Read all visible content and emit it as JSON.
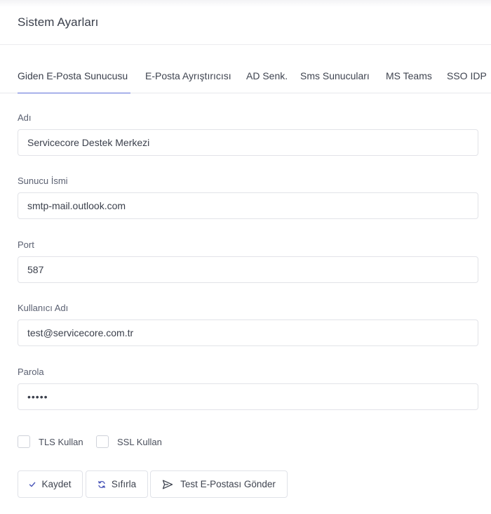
{
  "header": {
    "title": "Sistem Ayarları"
  },
  "tabs": [
    {
      "label": "Giden E-Posta Sunucusu",
      "active": true
    },
    {
      "label": "E-Posta Ayrıştırıcısı",
      "active": false
    },
    {
      "label": "AD Senk.",
      "active": false
    },
    {
      "label": "Sms Sunucuları",
      "active": false
    },
    {
      "label": "MS Teams",
      "active": false
    },
    {
      "label": "SSO IDP",
      "active": false
    }
  ],
  "form": {
    "name": {
      "label": "Adı",
      "value": "Servicecore Destek Merkezi"
    },
    "server": {
      "label": "Sunucu İsmi",
      "value": "smtp-mail.outlook.com"
    },
    "port": {
      "label": "Port",
      "value": "587"
    },
    "username": {
      "label": "Kullanıcı Adı",
      "value": "test@servicecore.com.tr"
    },
    "password": {
      "label": "Parola",
      "value": "•••••"
    },
    "tls": {
      "label": "TLS Kullan",
      "checked": false
    },
    "ssl": {
      "label": "SSL Kullan",
      "checked": false
    }
  },
  "actions": {
    "save": {
      "label": "Kaydet",
      "icon": "check-icon"
    },
    "reset": {
      "label": "Sıfırla",
      "icon": "refresh-icon"
    },
    "test": {
      "label": "Test E-Postası Gönder",
      "icon": "send-icon"
    }
  },
  "colors": {
    "accent": "#5c6ed8",
    "border": "#e2e3e8",
    "label": "#5b6172"
  }
}
